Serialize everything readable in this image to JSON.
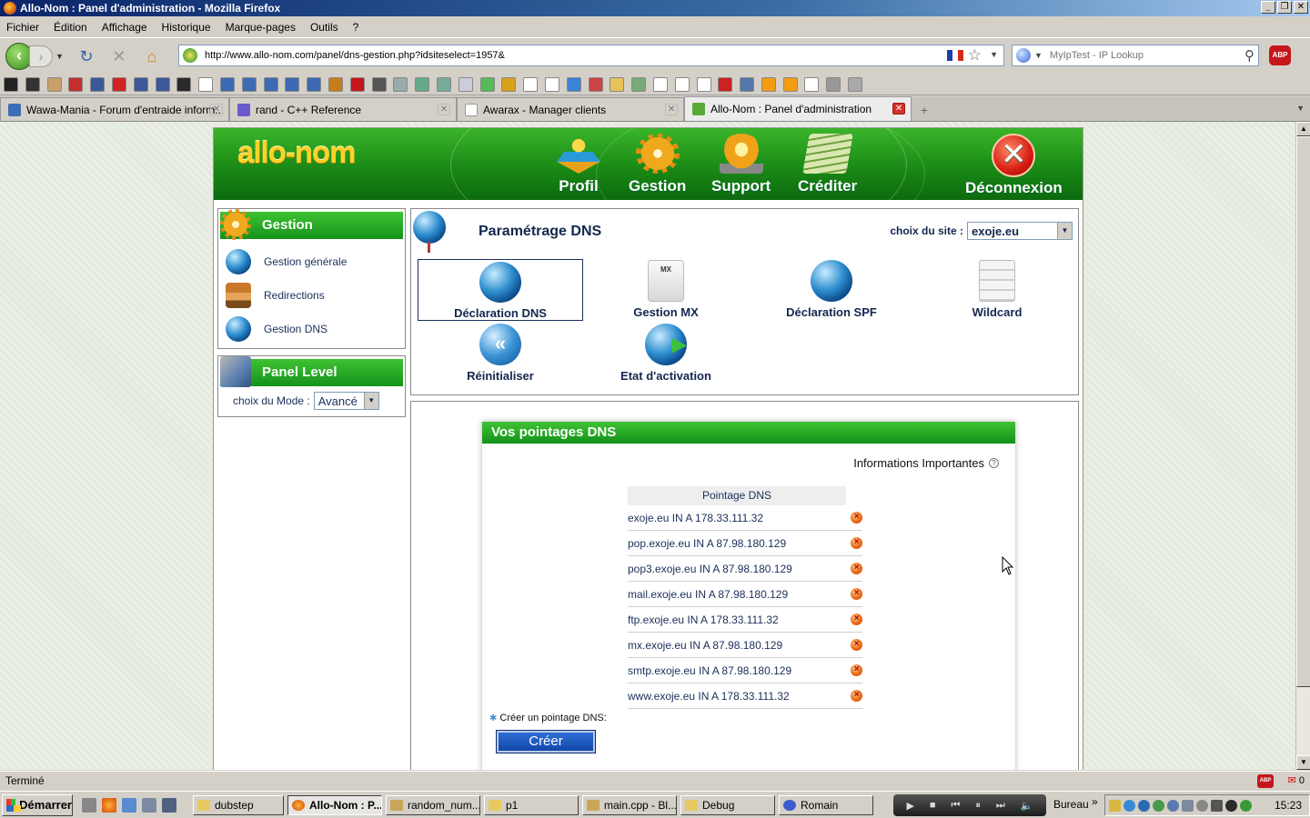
{
  "window": {
    "title": "Allo-Nom : Panel d'administration - Mozilla Firefox",
    "buttons": [
      "_",
      "❐",
      "✕"
    ]
  },
  "menu": [
    "Fichier",
    "Édition",
    "Affichage",
    "Historique",
    "Marque-pages",
    "Outils",
    "?"
  ],
  "navbar": {
    "url": "http://www.allo-nom.com/panel/dns-gestion.php?idsiteselect=1957&",
    "search_placeholder": "MyIpTest - IP Lookup",
    "abp_label": "ABP"
  },
  "bookmark_colors": [
    "#222",
    "#333",
    "#c9a06a",
    "#c3302c",
    "#3b5998",
    "#d12323",
    "#3b5998",
    "#3b5998",
    "#2a2a2a",
    "#fff",
    "#3d6bb3",
    "#3d6bb3",
    "#3d6bb3",
    "#3d6bb3",
    "#3d6bb3",
    "#c47f1a",
    "#c4161c",
    "#555",
    "#9aa",
    "#6a8",
    "#7a9",
    "#ccd",
    "#5b5",
    "#d9a11a",
    "#fff",
    "#fff",
    "#3a83d6",
    "#c44",
    "#e6c25a",
    "#7a7",
    "#fff",
    "#fff",
    "#fff",
    "#c22",
    "#57a",
    "#f39c12",
    "#f39c12",
    "#fff",
    "#999",
    "#aaa"
  ],
  "tabs": [
    {
      "label": "Wawa-Mania - Forum d'entraide inform...",
      "icon_color": "#3b6fb6"
    },
    {
      "label": "rand - C++ Reference",
      "icon_color": "#6a5acd"
    },
    {
      "label": "Awarax - Manager clients",
      "icon_color": "#ffffff"
    },
    {
      "label": "Allo-Nom : Panel d'administration",
      "icon_color": "#5aa838"
    }
  ],
  "site": {
    "logo": "allo-nom",
    "topnav": [
      "Profil",
      "Gestion",
      "Support",
      "Créditer",
      "Déconnexion"
    ],
    "sidebar": {
      "gestion_title": "Gestion",
      "items": [
        "Gestion générale",
        "Redirections",
        "Gestion DNS"
      ],
      "panel_level_title": "Panel Level",
      "mode_label": "choix du Mode :",
      "mode_value": "Avancé"
    },
    "panel": {
      "title": "Paramétrage DNS",
      "site_choice_label": "choix du site :",
      "site_choice_value": "exoje.eu",
      "tools": [
        "Déclaration DNS",
        "Gestion MX",
        "Déclaration SPF",
        "Wildcard",
        "Réinitialiser",
        "Etat d'activation"
      ]
    },
    "dns": {
      "title": "Vos pointages DNS",
      "info": "Informations Importantes",
      "info_icon": "?",
      "column_header": "Pointage DNS",
      "rows": [
        "exoje.eu IN A 178.33.111.32",
        "pop.exoje.eu IN A 87.98.180.129",
        "pop3.exoje.eu IN A 87.98.180.129",
        "mail.exoje.eu IN A 87.98.180.129",
        "ftp.exoje.eu IN A 178.33.111.32",
        "mx.exoje.eu IN A 87.98.180.129",
        "smtp.exoje.eu IN A 87.98.180.129",
        "www.exoje.eu IN A 178.33.111.32"
      ],
      "create_label": "Créer un pointage DNS:",
      "create_button": "Créer"
    }
  },
  "status": {
    "text": "Terminé",
    "mail_count": "0"
  },
  "taskbar": {
    "start": "Démarrer",
    "tasks": [
      "dubstep",
      "Allo-Nom : P...",
      "random_num...",
      "p1",
      "main.cpp - Bl...",
      "Debug",
      "Romain"
    ],
    "tray_label": "Bureau",
    "clock": "15:23"
  }
}
